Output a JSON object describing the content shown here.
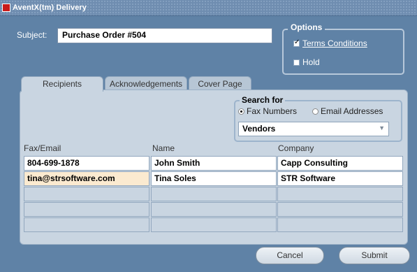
{
  "window": {
    "title": "AventX(tm) Delivery"
  },
  "subject": {
    "label": "Subject:",
    "value": "Purchase Order #504"
  },
  "options": {
    "title": "Options",
    "terms": {
      "label": "Terms Conditions",
      "checked": true
    },
    "hold": {
      "label": "Hold",
      "checked": false
    }
  },
  "tabs": [
    {
      "label": "Recipients",
      "active": true
    },
    {
      "label": "Acknowledgements",
      "active": false
    },
    {
      "label": "Cover Page",
      "active": false
    }
  ],
  "search": {
    "title": "Search for",
    "fax": {
      "label": "Fax Numbers",
      "selected": true
    },
    "email": {
      "label": "Email Addresses",
      "selected": false
    },
    "dropdown": "Vendors"
  },
  "table": {
    "headers": [
      "Fax/Email",
      "Name",
      "Company"
    ],
    "rows": [
      [
        "804-699-1878",
        "John Smith",
        "Capp Consulting"
      ],
      [
        "tina@strsoftware.com",
        "Tina Soles",
        "STR Software"
      ],
      [
        "",
        "",
        ""
      ],
      [
        "",
        "",
        ""
      ],
      [
        "",
        "",
        ""
      ]
    ]
  },
  "buttons": {
    "cancel": "Cancel",
    "submit": "Submit"
  }
}
